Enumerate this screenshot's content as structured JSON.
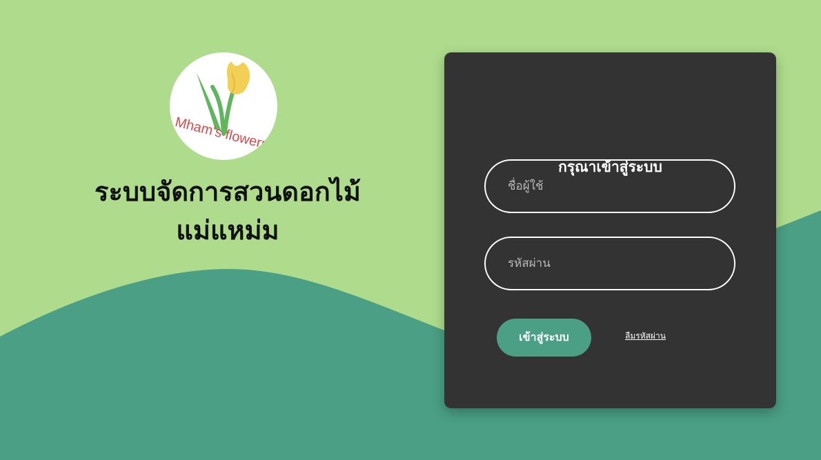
{
  "theme": {
    "background_top": "#aedc8c",
    "background_wave": "#4a9f84",
    "card_background": "#333333",
    "accent": "#4a9f84"
  },
  "brand": {
    "logo_text": "Mham's flowers",
    "title_line1": "ระบบจัดการสวนดอกไม้",
    "title_line2": "แม่แหม่ม"
  },
  "login": {
    "title": "กรุณาเข้าสู่ระบบ",
    "username_placeholder": "ชื่อผู้ใช้",
    "password_placeholder": "รหัสผ่าน",
    "submit_label": "เข้าสู่ระบบ",
    "forgot_label": "ลืมรหัสผ่าน"
  }
}
